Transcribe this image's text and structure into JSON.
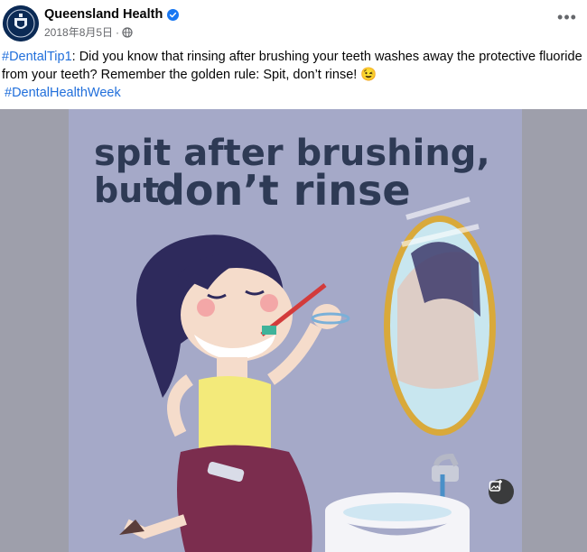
{
  "post": {
    "author": "Queensland Health",
    "date": "2018年8月5日",
    "separator": "·",
    "hashtag1": "#DentalTip1",
    "body": ": Did you know that rinsing after brushing your teeth washes away the protective fluoride from your teeth? Remember the golden rule: Spit, don’t rinse! 😉",
    "hashtag2": "#DentalHealthWeek"
  },
  "image": {
    "headline_line1": "spit after brushing,",
    "headline_line2_small": "but",
    "headline_line2_big": "don’t rinse"
  },
  "icons": {
    "verified": "verified-badge-icon",
    "privacy": "globe-icon",
    "more": "more-options-icon",
    "add_photo": "add-photo-icon"
  },
  "colors": {
    "link": "#216fdb",
    "verified": "#1877f2",
    "headline": "#2e3a55",
    "image_bg": "#9e9fab"
  }
}
